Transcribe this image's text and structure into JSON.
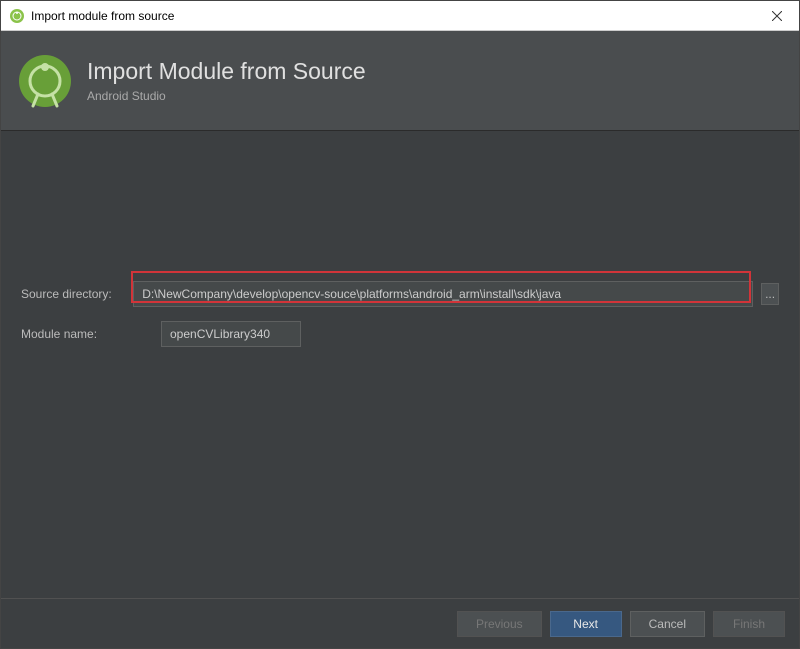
{
  "window": {
    "title": "Import module from source"
  },
  "header": {
    "title": "Import Module from Source",
    "subtitle": "Android Studio"
  },
  "form": {
    "source_label": "Source directory:",
    "source_value": "D:\\NewCompany\\develop\\opencv-souce\\platforms\\android_arm\\install\\sdk\\java",
    "module_label": "Module name:",
    "module_value": "openCVLibrary340",
    "browse_label": "..."
  },
  "footer": {
    "previous": "Previous",
    "next": "Next",
    "cancel": "Cancel",
    "finish": "Finish"
  }
}
